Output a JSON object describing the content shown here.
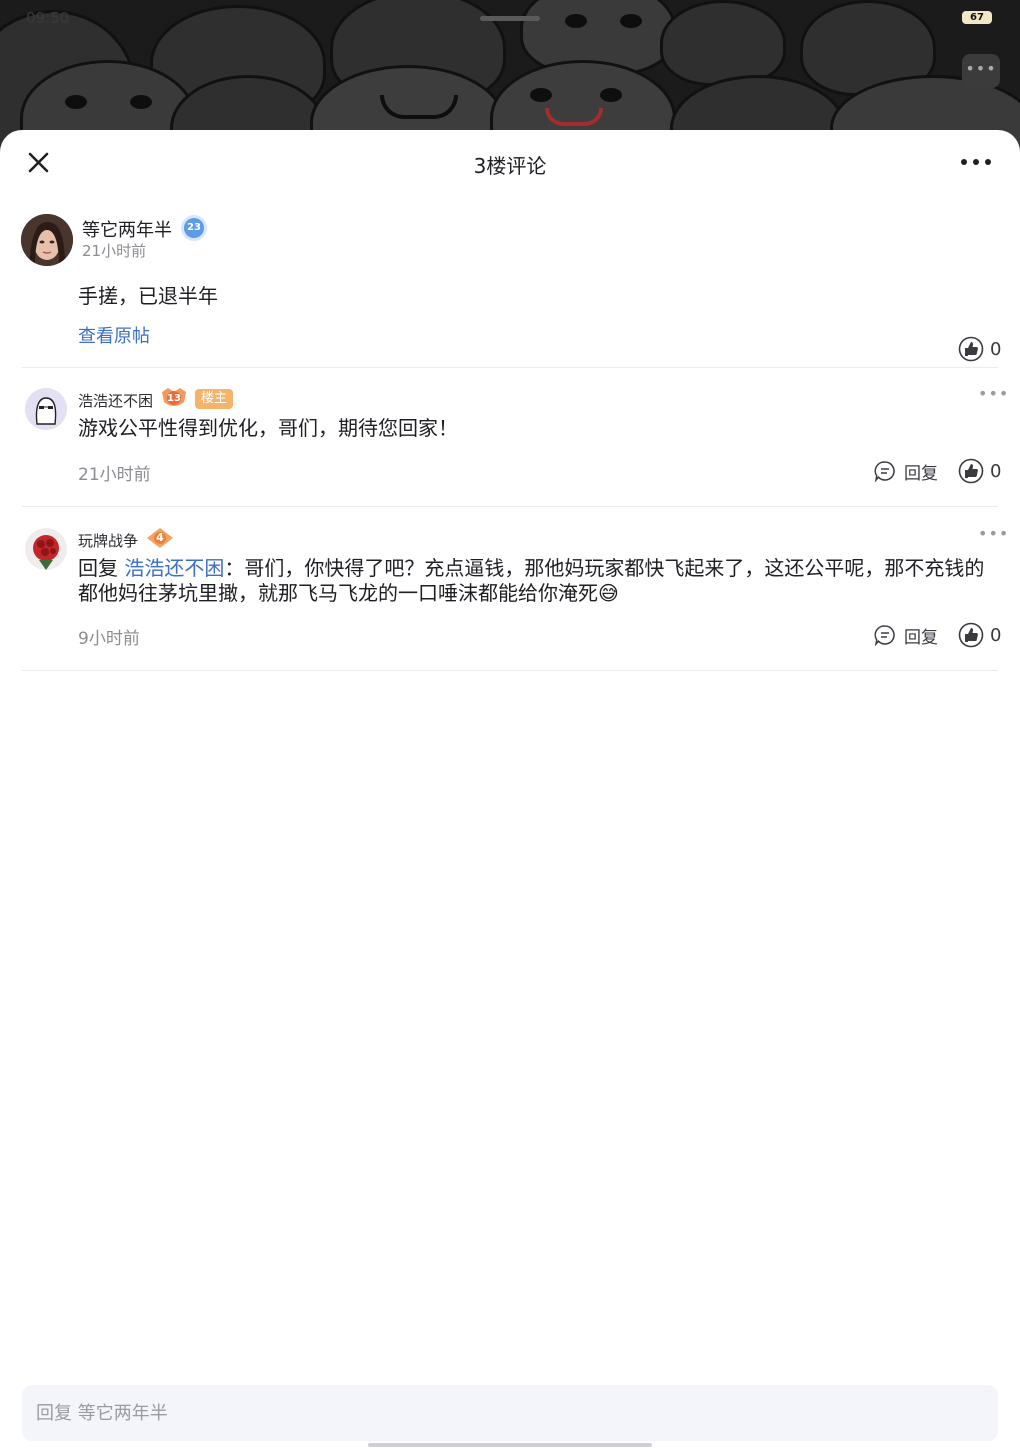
{
  "status_bar": {
    "time": "09:50",
    "battery": "67"
  },
  "sheet": {
    "title": "3楼评论"
  },
  "post": {
    "username": "等它两年半",
    "level": "23",
    "time": "21小时前",
    "content": "手搓，已退半年",
    "view_original": "查看原帖",
    "likes": "0"
  },
  "comments": [
    {
      "username": "浩浩还不困",
      "level": "13",
      "tag": "楼主",
      "text": "游戏公平性得到优化，哥们，期待您回家！",
      "time": "21小时前",
      "reply_label": "回复",
      "likes": "0"
    },
    {
      "username": "玩牌战争",
      "level": "4",
      "reply_prefix": "回复 ",
      "reply_to": "浩浩还不困",
      "text": "：哥们，你快得了吧？充点逼钱，那他妈玩家都快飞起来了，这还公平呢，那不充钱的都他妈往茅坑里撖，就那飞马飞龙的一口唾沫都能给你淹死😅",
      "time": "9小时前",
      "reply_label": "回复",
      "likes": "0"
    }
  ],
  "input": {
    "placeholder": "回复 等它两年半"
  },
  "colors": {
    "link": "#3d6fc4",
    "host_tag": "#f4b56a",
    "muted": "#8c8c92"
  }
}
